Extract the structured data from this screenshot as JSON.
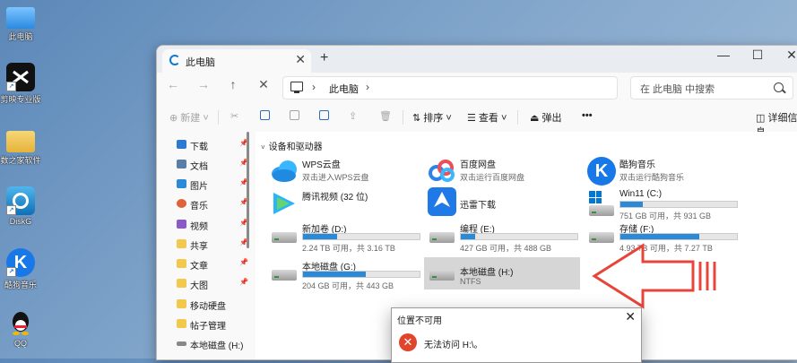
{
  "desktop": {
    "icons": [
      {
        "label": "此电脑",
        "icon": "computer-icon",
        "color": "#3aa0f5"
      },
      {
        "label": "剪映专业版",
        "icon": "capcut-icon",
        "color": "#111111"
      },
      {
        "label": "数之家软件",
        "icon": "folder-icon",
        "color": "#f2c94c"
      },
      {
        "label": "DiskG",
        "icon": "diskgenius-icon",
        "color": "#1f8ad1"
      },
      {
        "label": "酷狗音乐",
        "icon": "kugou-icon",
        "color": "#1878e8"
      },
      {
        "label": "QQ",
        "icon": "qq-icon",
        "color": "#ffffff"
      }
    ]
  },
  "window": {
    "tab_title": "此电脑",
    "tab_close": "✕",
    "new_tab": "+",
    "minimize": "—",
    "maximize": "☐",
    "close": "✕"
  },
  "nav": {
    "back": "←",
    "forward": "→",
    "up": "↑",
    "cancel": "✕",
    "breadcrumb_sep": "›",
    "address": "此电脑",
    "search_placeholder": "在 此电脑 中搜索"
  },
  "toolbar": {
    "new_label": "新建",
    "sort_label": "排序",
    "view_label": "查看",
    "eject_label": "弹出",
    "more": "•••",
    "details_label": "详细信息"
  },
  "sidebar": {
    "items": [
      {
        "label": "下载",
        "icon": "download-icon",
        "color": "#2e7ad1"
      },
      {
        "label": "文档",
        "icon": "document-icon",
        "color": "#5b7ea8"
      },
      {
        "label": "图片",
        "icon": "pictures-icon",
        "color": "#2a8ad8"
      },
      {
        "label": "音乐",
        "icon": "music-icon",
        "color": "#e0623a"
      },
      {
        "label": "视频",
        "icon": "videos-icon",
        "color": "#8a5bc8"
      },
      {
        "label": "共享",
        "icon": "folder-icon",
        "color": "#f2c94c"
      },
      {
        "label": "文章",
        "icon": "folder-icon",
        "color": "#f2c94c"
      },
      {
        "label": "大图",
        "icon": "folder-icon",
        "color": "#f2c94c"
      },
      {
        "label": "移动硬盘",
        "icon": "folder-icon",
        "color": "#f2c94c"
      },
      {
        "label": "帖子管理",
        "icon": "folder-icon",
        "color": "#f2c94c"
      },
      {
        "label": "本地磁盘 (H:)",
        "icon": "drive-icon",
        "color": "#888888"
      }
    ],
    "pin": "📌"
  },
  "main": {
    "group_title": "设备和驱动器",
    "drives": [
      {
        "name": "WPS云盘",
        "sub": "双击进入WPS云盘",
        "icon": "wps-cloud-icon"
      },
      {
        "name": "百度网盘",
        "sub": "双击运行百度网盘",
        "icon": "baidu-netdisk-icon"
      },
      {
        "name": "酷狗音乐",
        "sub": "双击运行酷狗音乐",
        "icon": "kugou-icon"
      },
      {
        "name": "腾讯视频 (32 位)",
        "sub": "",
        "icon": "tencent-video-icon"
      },
      {
        "name": "迅雷下载",
        "sub": "",
        "icon": "thunder-icon"
      },
      {
        "name": "Win11 (C:)",
        "sub": "751 GB 可用，共 931 GB",
        "icon": "windows-drive-icon",
        "used": 0.19
      },
      {
        "name": "新加卷 (D:)",
        "sub": "2.24 TB 可用，共 3.16 TB",
        "icon": "hdd-icon",
        "used": 0.29
      },
      {
        "name": "编程 (E:)",
        "sub": "427 GB 可用，共 488 GB",
        "icon": "hdd-icon",
        "used": 0.12
      },
      {
        "name": "存储 (F:)",
        "sub": "4.93 TB 可用，共 7.27 TB",
        "icon": "hdd-icon",
        "used": 0.68
      },
      {
        "name": "本地磁盘 (G:)",
        "sub": "204 GB 可用，共 443 GB",
        "icon": "hdd-icon",
        "used": 0.54
      },
      {
        "name": "本地磁盘 (H:)",
        "sub": "NTFS",
        "icon": "hdd-icon"
      }
    ]
  },
  "dialog": {
    "title": "位置不可用",
    "close": "✕",
    "error_glyph": "✕",
    "message": "无法访问 H:\\。"
  },
  "colors": {
    "accent": "#0067c0",
    "bar_fill": "#2a8ad8",
    "arrow": "#e8443a",
    "error": "#e0452b"
  }
}
